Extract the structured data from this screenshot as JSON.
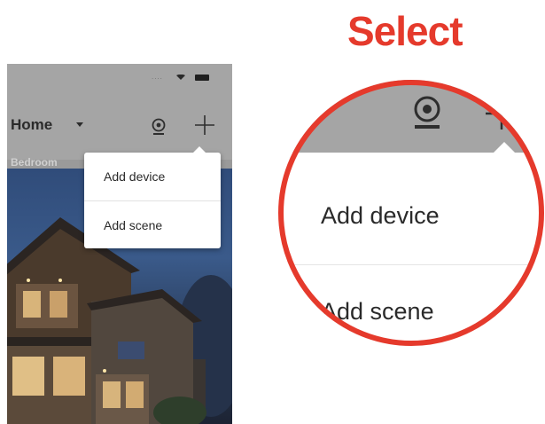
{
  "heading": "Select",
  "phone": {
    "status_signal": "....",
    "home_label": "Home",
    "tab_label": "Bedroom",
    "menu": {
      "add_device": "Add device",
      "add_scene": "Add scene"
    }
  },
  "zoom": {
    "add_device": "Add device",
    "add_scene": "Add scene"
  },
  "icons": {
    "camera": "camera-icon",
    "add": "plus-icon",
    "dropdown": "chevron-down-icon"
  },
  "colors": {
    "accent_red": "#e53a2c",
    "header_gray": "#a5a5a5",
    "menu_white": "#ffffff"
  }
}
